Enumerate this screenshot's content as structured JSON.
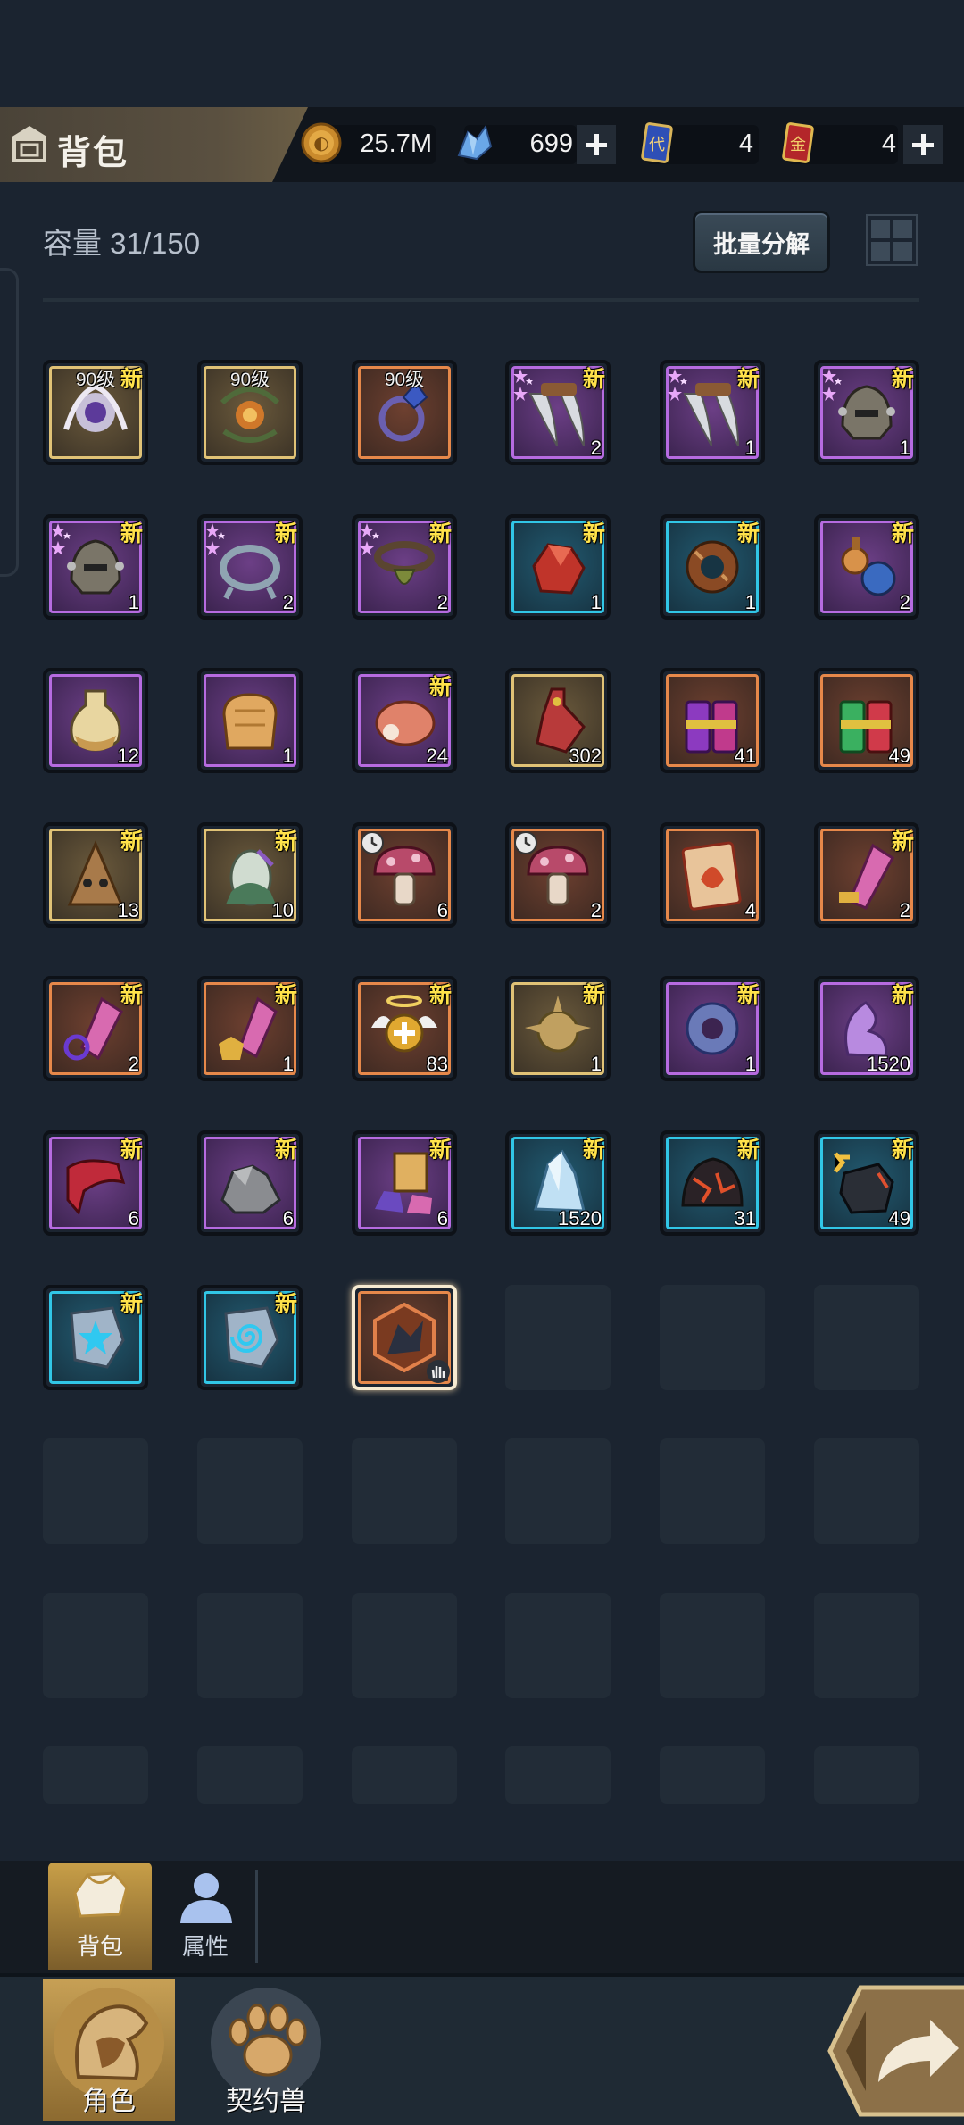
{
  "header": {
    "title": "背包",
    "currencies": [
      {
        "name": "gold-coin-icon",
        "value": "25.7M",
        "has_plus": false
      },
      {
        "name": "blue-crystal-icon",
        "value": "699",
        "has_plus": true
      },
      {
        "name": "blue-ticket-icon",
        "value": "4",
        "has_plus": false
      },
      {
        "name": "red-ticket-icon",
        "value": "4",
        "has_plus": true
      }
    ]
  },
  "toolbar": {
    "capacity": "容量 31/150",
    "batch_button": "批量分解"
  },
  "items": [
    {
      "icon": "wing-amulet-icon",
      "rarity": "gold",
      "level": "90级",
      "new": "新",
      "qty": ""
    },
    {
      "icon": "vine-amulet-icon",
      "rarity": "gold",
      "level": "90级",
      "new": "",
      "qty": ""
    },
    {
      "icon": "ring-icon",
      "rarity": "orange",
      "level": "90级",
      "new": "",
      "qty": ""
    },
    {
      "icon": "claw-icon",
      "rarity": "purple",
      "level": "",
      "new": "新",
      "qty": "2",
      "stars": true
    },
    {
      "icon": "claw-icon",
      "rarity": "purple",
      "level": "",
      "new": "新",
      "qty": "1",
      "stars": true
    },
    {
      "icon": "spiked-helmet-icon",
      "rarity": "purple",
      "level": "",
      "new": "新",
      "qty": "1",
      "stars": true
    },
    {
      "icon": "spiked-helmet-icon",
      "rarity": "purple",
      "level": "",
      "new": "新",
      "qty": "1",
      "stars": true
    },
    {
      "icon": "iron-ring-icon",
      "rarity": "purple",
      "level": "",
      "new": "新",
      "qty": "2",
      "stars": true
    },
    {
      "icon": "bell-collar-icon",
      "rarity": "purple",
      "level": "",
      "new": "新",
      "qty": "2",
      "stars": true
    },
    {
      "icon": "red-ore-icon",
      "rarity": "blue",
      "level": "",
      "new": "新",
      "qty": "1"
    },
    {
      "icon": "wood-ring-icon",
      "rarity": "blue",
      "level": "",
      "new": "新",
      "qty": "1"
    },
    {
      "icon": "potion-bottles-icon",
      "rarity": "purple",
      "level": "",
      "new": "新",
      "qty": "2"
    },
    {
      "icon": "elixir-bottle-icon",
      "rarity": "purple",
      "level": "",
      "new": "",
      "qty": "12"
    },
    {
      "icon": "bread-icon",
      "rarity": "purple",
      "level": "",
      "new": "",
      "qty": "1"
    },
    {
      "icon": "ham-icon",
      "rarity": "purple",
      "level": "",
      "new": "新",
      "qty": "24"
    },
    {
      "icon": "red-potion-icon",
      "rarity": "gold",
      "level": "",
      "new": "",
      "qty": "302"
    },
    {
      "icon": "firecracker-purple-icon",
      "rarity": "orange",
      "level": "",
      "new": "",
      "qty": "41"
    },
    {
      "icon": "firecracker-green-icon",
      "rarity": "orange",
      "level": "",
      "new": "",
      "qty": "49"
    },
    {
      "icon": "treant-icon",
      "rarity": "gold",
      "level": "",
      "new": "新",
      "qty": "13"
    },
    {
      "icon": "egg-icon",
      "rarity": "gold",
      "level": "",
      "new": "新",
      "qty": "10"
    },
    {
      "icon": "mushroom-icon",
      "rarity": "orange",
      "level": "",
      "new": "",
      "qty": "6",
      "clock": true
    },
    {
      "icon": "mushroom-icon",
      "rarity": "orange",
      "level": "",
      "new": "",
      "qty": "2",
      "clock": true
    },
    {
      "icon": "scroll-icon",
      "rarity": "orange",
      "level": "",
      "new": "",
      "qty": "4"
    },
    {
      "icon": "crystal-shard-icon",
      "rarity": "orange",
      "level": "",
      "new": "新",
      "qty": "2"
    },
    {
      "icon": "crystal-ring-icon",
      "rarity": "orange",
      "level": "",
      "new": "新",
      "qty": "2"
    },
    {
      "icon": "crystal-armor-icon",
      "rarity": "orange",
      "level": "",
      "new": "新",
      "qty": "1"
    },
    {
      "icon": "angel-badge-icon",
      "rarity": "orange",
      "level": "",
      "new": "新",
      "qty": "83"
    },
    {
      "icon": "spike-ball-icon",
      "rarity": "gold",
      "level": "",
      "new": "新",
      "qty": "1"
    },
    {
      "icon": "stone-ring-icon",
      "rarity": "purple",
      "level": "",
      "new": "新",
      "qty": "1"
    },
    {
      "icon": "purple-crystal-icon",
      "rarity": "purple",
      "level": "",
      "new": "新",
      "qty": "1520"
    },
    {
      "icon": "red-cloth-icon",
      "rarity": "purple",
      "level": "",
      "new": "新",
      "qty": "6"
    },
    {
      "icon": "grey-rock-icon",
      "rarity": "purple",
      "level": "",
      "new": "新",
      "qty": "6"
    },
    {
      "icon": "gem-pile-icon",
      "rarity": "purple",
      "level": "",
      "new": "新",
      "qty": "6"
    },
    {
      "icon": "ice-crystal-icon",
      "rarity": "blue",
      "level": "",
      "new": "新",
      "qty": "1520"
    },
    {
      "icon": "lava-rock-icon",
      "rarity": "blue",
      "level": "",
      "new": "新",
      "qty": "31"
    },
    {
      "icon": "dark-stone-icon",
      "rarity": "blue",
      "level": "",
      "new": "新",
      "qty": "49"
    },
    {
      "icon": "star-rune-icon",
      "rarity": "blue",
      "level": "",
      "new": "新",
      "qty": ""
    },
    {
      "icon": "spiral-rune-icon",
      "rarity": "blue",
      "level": "",
      "new": "新",
      "qty": ""
    },
    {
      "icon": "beast-emblem-icon",
      "rarity": "orange",
      "level": "",
      "new": "",
      "qty": "",
      "selected": true
    }
  ],
  "empty_slots": 24,
  "tabs": [
    {
      "label": "背包",
      "active": true
    },
    {
      "label": "属性",
      "active": false
    }
  ],
  "nav": [
    {
      "label": "角色",
      "active": true
    },
    {
      "label": "契约兽",
      "active": false
    }
  ],
  "colors": {
    "background": "#1b2430",
    "new_badge": "#ffe24a",
    "rarity_purple": "#b66be0",
    "rarity_gold": "#e0c276",
    "rarity_orange": "#e6884a",
    "rarity_blue": "#31c6e6"
  }
}
